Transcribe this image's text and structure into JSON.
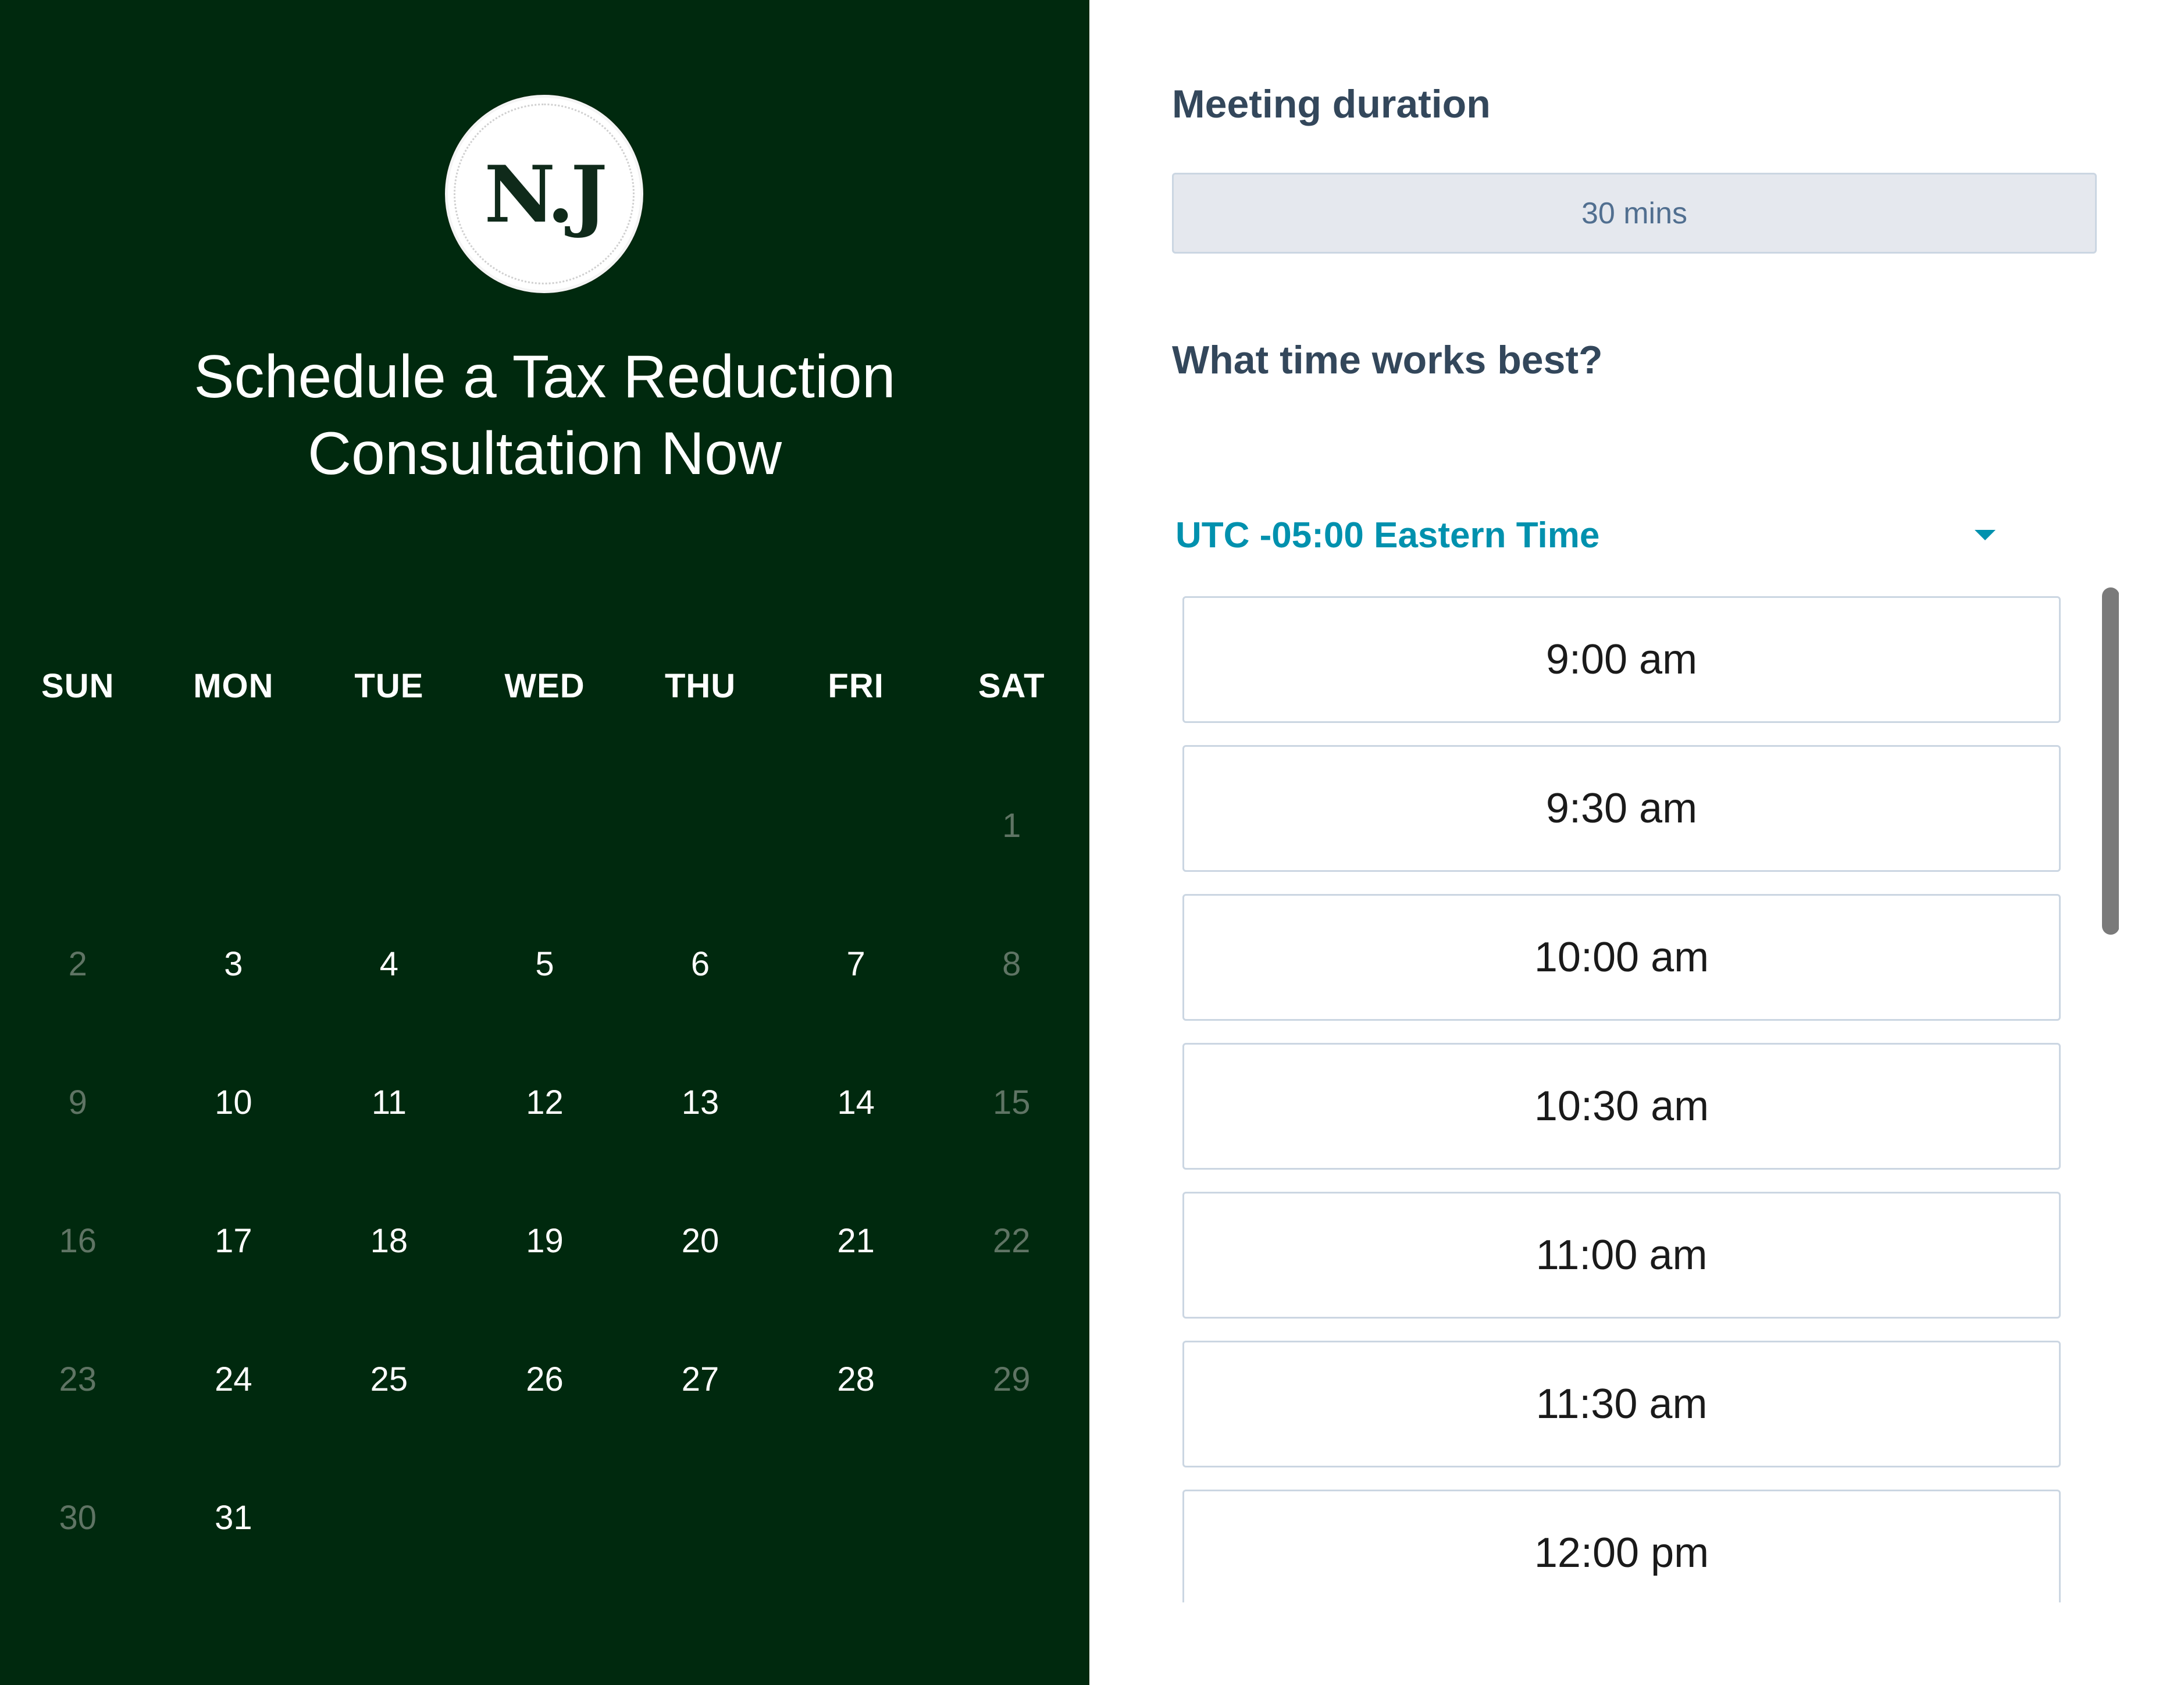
{
  "left": {
    "logo_text": "N.J",
    "title_line1": "Schedule a Tax Reduction",
    "title_line2": "Consultation Now"
  },
  "calendar": {
    "weekdays": [
      "SUN",
      "MON",
      "TUE",
      "WED",
      "THU",
      "FRI",
      "SAT"
    ],
    "weeks": [
      [
        "",
        "",
        "",
        "",
        "",
        "",
        "1"
      ],
      [
        "2",
        "3",
        "4",
        "5",
        "6",
        "7",
        "8"
      ],
      [
        "9",
        "10",
        "11",
        "12",
        "13",
        "14",
        "15"
      ],
      [
        "16",
        "17",
        "18",
        "19",
        "20",
        "21",
        "22"
      ],
      [
        "23",
        "24",
        "25",
        "26",
        "27",
        "28",
        "29"
      ],
      [
        "30",
        "31",
        "",
        "",
        "",
        "",
        ""
      ]
    ],
    "available_days": [
      "3",
      "4",
      "5",
      "6",
      "7",
      "10",
      "11",
      "12",
      "13",
      "14",
      "17",
      "18",
      "19",
      "20",
      "21",
      "24",
      "25",
      "26",
      "27",
      "28",
      "31"
    ]
  },
  "right": {
    "duration_label": "Meeting duration",
    "duration_value": "30 mins",
    "time_question": "What time works best?",
    "timezone": "UTC -05:00 Eastern Time",
    "slots": [
      "9:00 am",
      "9:30 am",
      "10:00 am",
      "10:30 am",
      "11:00 am",
      "11:30 am",
      "12:00 pm"
    ]
  },
  "colors": {
    "left_bg": "#00290e",
    "accent": "#0091ae",
    "label": "#33475b"
  }
}
